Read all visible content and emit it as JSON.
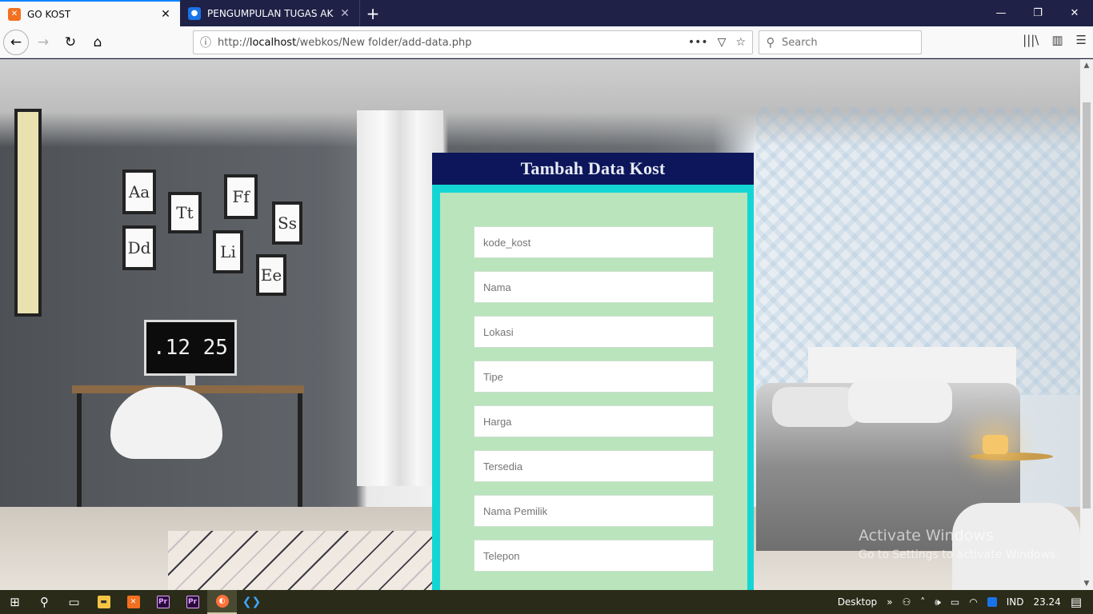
{
  "browser": {
    "tabs": [
      {
        "title": "GO KOST",
        "active": true,
        "favicon": "xampp-icon",
        "favicon_color": "#f37021"
      },
      {
        "title": "PENGUMPULAN TUGAS AKHIR",
        "active": false,
        "favicon": "classroom-icon",
        "favicon_color": "#1a73e8"
      }
    ],
    "new_tab_glyph": "+",
    "close_glyph": "✕",
    "window_controls": {
      "minimize": "—",
      "restore": "❐",
      "close": "✕"
    },
    "url": {
      "prefix": "http://",
      "host": "localhost",
      "path": "/webkos/New folder/add-data.php"
    },
    "page_actions": {
      "more": "•••",
      "pocket": "▽",
      "bookmark": "☆"
    },
    "search_placeholder": "Search",
    "toolbar_icons": {
      "library": "|||\\",
      "sidebar": "▥",
      "menu": "☰"
    }
  },
  "page": {
    "monitor_clock": ".12 25",
    "frames": [
      "Aa",
      "Tt",
      "Ff",
      "Ss",
      "Dd",
      "Li",
      "Ee"
    ],
    "form": {
      "title": "Tambah Data Kost",
      "fields": [
        {
          "placeholder": "kode_kost"
        },
        {
          "placeholder": "Nama"
        },
        {
          "placeholder": "Lokasi"
        },
        {
          "placeholder": "Tipe"
        },
        {
          "placeholder": "Harga"
        },
        {
          "placeholder": "Tersedia"
        },
        {
          "placeholder": "Nama Pemilik"
        },
        {
          "placeholder": "Telepon"
        }
      ]
    },
    "watermark": {
      "line1": "Activate Windows",
      "line2": "Go to Settings to activate Windows."
    }
  },
  "taskbar": {
    "desktop_label": "Desktop",
    "language": "IND",
    "clock": "23.24",
    "apps": [
      "file-explorer",
      "xampp",
      "premiere-pro",
      "premiere-pro",
      "firefox",
      "vscode"
    ]
  },
  "colors": {
    "tab_strip": "#1f2147",
    "form_header": "#0d165a",
    "form_border": "#13d6d4",
    "form_body": "#b9e4bc",
    "taskbar": "#2b2b19"
  }
}
